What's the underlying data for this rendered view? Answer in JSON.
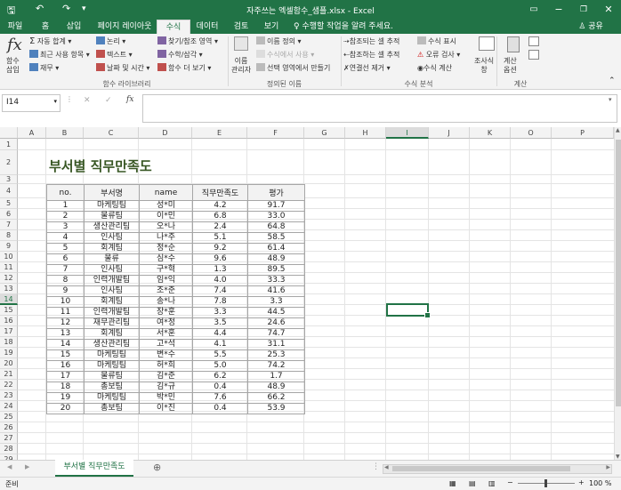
{
  "titlebar": {
    "title": "자주쓰는 엑셀함수_샘플.xlsx - Excel",
    "save_icon": "save-icon",
    "undo_icon": "undo-icon",
    "redo_icon": "redo-icon",
    "qat_more_icon": "chevron-down-icon"
  },
  "tabs": [
    "파일",
    "홈",
    "삽입",
    "페이지 레이아웃",
    "수식",
    "데이터",
    "검토",
    "보기"
  ],
  "active_tab": "수식",
  "tell_me": "수행할 작업을 알려 주세요.",
  "share": "공유",
  "ribbon": {
    "insert_function": [
      "함수",
      "삽입"
    ],
    "library": {
      "autosum": "자동 합계",
      "recent": "최근 사용 항목",
      "finance": "재무",
      "logical": "논리",
      "text": "텍스트",
      "datetime": "날짜 및 시간",
      "lookup": "찾기/참조 영역",
      "math": "수학/삼각",
      "more": "함수 더 보기",
      "group_label": "함수 라이브러리"
    },
    "names": {
      "name_manager": [
        "이름",
        "관리자"
      ],
      "define_name": "이름 정의",
      "use_in_formula": "수식에서 사용",
      "create_from_selection": "선택 영역에서 만들기",
      "group_label": "정의된 이름"
    },
    "auditing": {
      "trace_precedents": "참조되는 셀 추적",
      "trace_dependents": "참조하는 셀 추적",
      "remove_arrows": "연결선 제거",
      "show_formulas": "수식 표시",
      "error_checking": "오류 검사",
      "evaluate": "수식 계산",
      "watch": [
        "조사식",
        "창"
      ],
      "group_label": "수식 분석"
    },
    "calc": {
      "options": [
        "계산",
        "옵션"
      ],
      "group_label": "계산"
    }
  },
  "formula_bar": {
    "name_box": "I14",
    "cancel": "✕",
    "enter": "✓",
    "fx": "fx",
    "value": ""
  },
  "columns": [
    "A",
    "B",
    "C",
    "D",
    "E",
    "F",
    "G",
    "H",
    "I",
    "J",
    "K",
    "O",
    "P"
  ],
  "selected_column": "I",
  "rows": [
    "1",
    "2",
    "3",
    "4",
    "5",
    "6",
    "7",
    "8",
    "9",
    "10",
    "11",
    "12",
    "13",
    "14",
    "15",
    "16",
    "17",
    "18",
    "19",
    "20",
    "21",
    "22",
    "23",
    "24",
    "25",
    "26",
    "27",
    "28",
    "29"
  ],
  "selected_row": "14",
  "sheet": {
    "title": "부서별 직무만족도",
    "headers": [
      "no.",
      "부서명",
      "name",
      "직무만족도",
      "평가"
    ],
    "rows": [
      [
        "1",
        "마케팅팀",
        "성*미",
        "4.2",
        "91.7"
      ],
      [
        "2",
        "물류팀",
        "이*민",
        "6.8",
        "33.0"
      ],
      [
        "3",
        "생산관리팀",
        "오*나",
        "2.4",
        "64.8"
      ],
      [
        "4",
        "인사팀",
        "나*주",
        "5.1",
        "58.5"
      ],
      [
        "5",
        "회계팀",
        "정*순",
        "9.2",
        "61.4"
      ],
      [
        "6",
        "물류",
        "심*수",
        "9.6",
        "48.9"
      ],
      [
        "7",
        "인사팀",
        "구*혁",
        "1.3",
        "89.5"
      ],
      [
        "8",
        "인력개발팀",
        "임*익",
        "4.0",
        "33.3"
      ],
      [
        "9",
        "인사팀",
        "조*준",
        "7.4",
        "41.6"
      ],
      [
        "10",
        "회계팀",
        "송*나",
        "7.8",
        "3.3"
      ],
      [
        "11",
        "인력개발팀",
        "장*훈",
        "3.3",
        "44.5"
      ],
      [
        "12",
        "재무관리팀",
        "여*정",
        "3.5",
        "24.6"
      ],
      [
        "13",
        "회계팀",
        "서*훈",
        "4.4",
        "74.7"
      ],
      [
        "14",
        "생산관리팀",
        "고*석",
        "4.1",
        "31.1"
      ],
      [
        "15",
        "마케팅팀",
        "변*수",
        "5.5",
        "25.3"
      ],
      [
        "16",
        "마케팅팀",
        "허*희",
        "5.0",
        "74.2"
      ],
      [
        "17",
        "물류팀",
        "김*준",
        "6.2",
        "1.7"
      ],
      [
        "18",
        "총보팀",
        "김*규",
        "0.4",
        "48.9"
      ],
      [
        "19",
        "마케팅팀",
        "박*민",
        "7.6",
        "66.2"
      ],
      [
        "20",
        "총보팀",
        "이*진",
        "0.4",
        "53.9"
      ]
    ]
  },
  "sheet_tabs": [
    "부서별 직무만족도"
  ],
  "add_sheet": "⊕",
  "status": {
    "mode": "준비",
    "zoom_minus": "−",
    "zoom_plus": "+",
    "zoom": "100 %"
  },
  "colors": {
    "accent": "#217346",
    "title_text": "#375623"
  }
}
